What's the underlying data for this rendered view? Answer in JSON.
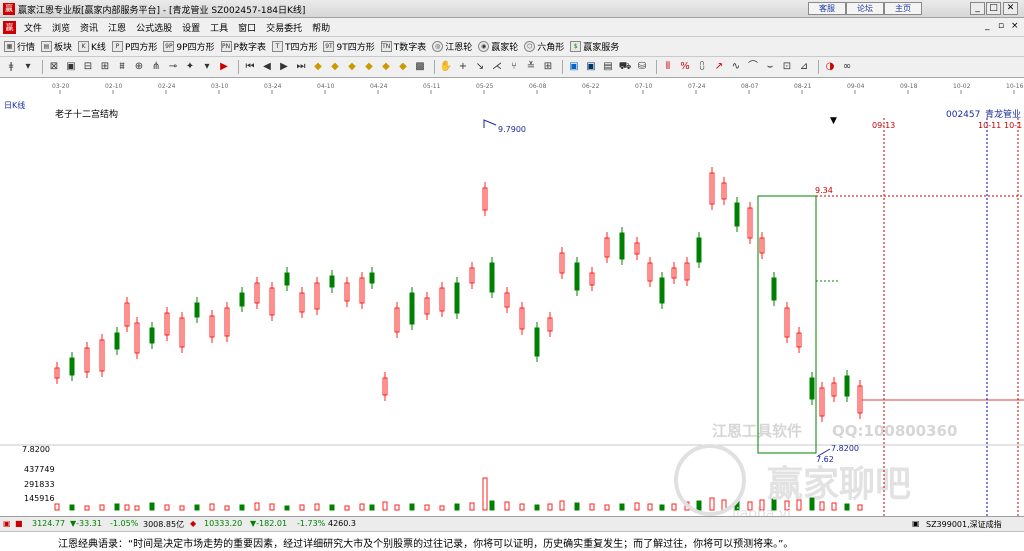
{
  "window": {
    "title": "赢家江恩专业版[赢家内部服务平台] - [青龙管业  SZ002457-184日K线]",
    "buttons": [
      "客服",
      "论坛",
      "主页"
    ]
  },
  "menu": {
    "items": [
      "文件",
      "浏览",
      "资讯",
      "江恩",
      "公式选股",
      "设置",
      "工具",
      "窗口",
      "交易委托",
      "帮助"
    ]
  },
  "toolbar1": {
    "items": [
      {
        "label": "行情",
        "icon": "grid-icon"
      },
      {
        "label": "板块",
        "icon": "blocks-icon"
      },
      {
        "label": "K线",
        "icon": "kline-icon"
      },
      {
        "label": "P四方形",
        "icon": "p-square-icon"
      },
      {
        "label": "9P四方形",
        "icon": "9p-square-icon"
      },
      {
        "label": "P数字表",
        "icon": "pn-table-icon"
      },
      {
        "label": "T四方形",
        "icon": "t-square-icon"
      },
      {
        "label": "9T四方形",
        "icon": "9t-square-icon"
      },
      {
        "label": "T数字表",
        "icon": "tn-table-icon"
      },
      {
        "label": "江恩轮",
        "icon": "gann-wheel-icon"
      },
      {
        "label": "赢家轮",
        "icon": "winner-wheel-icon"
      },
      {
        "label": "六角形",
        "icon": "hexagon-icon"
      },
      {
        "label": "赢家服务",
        "icon": "dollar-icon"
      }
    ]
  },
  "chart": {
    "panel_label": "日K线",
    "indicator": "老子十二宫结构",
    "stock_code": "002457",
    "stock_name": "青龙管业",
    "date_axis": [
      "03-20",
      "02-10",
      "02-24",
      "03-10",
      "03-24",
      "04-10",
      "04-24",
      "05-11",
      "05-25",
      "06-08",
      "06-22",
      "07-10",
      "07-24",
      "08-07",
      "08-21",
      "09-04",
      "09-18",
      "10-02",
      "10-16"
    ],
    "high_label": "9.7900",
    "box_high_label": "9.34",
    "low_label": "7.8200",
    "box_low_label": "7.62",
    "ref_low": "7.8200",
    "date_label_1": "09-13",
    "date_label_2": "10-11",
    "date_label_3": "10-1",
    "volume_labels": [
      "437749",
      "291833",
      "145916"
    ],
    "watermark_1": "江恩工具软件",
    "watermark_2": "QQ:100800360",
    "watermark_3": "赢家聊吧",
    "watermark_4": "liaoba.vi"
  },
  "status": {
    "sh_index": "3124.77",
    "sh_change": "▼-33.31",
    "sh_pct": "-1.05%",
    "sh_amount": "3008.85亿",
    "sz_index": "10333.20",
    "sz_change": "▼-182.01",
    "sz_pct": "-1.73%",
    "sz_amount": "4260.3",
    "right_text": "SZ399001,深证成指"
  },
  "quote": "江恩经典语录：“时间是决定市场走势的重要因素，经过详细研究大市及个别股票的过往记录，你将可以证明，历史确实重复发生；而了解过往，你将可以预测将来。”。",
  "colors": {
    "up": "#ff2020",
    "down": "#008000",
    "accent": "#1a2a9c"
  }
}
